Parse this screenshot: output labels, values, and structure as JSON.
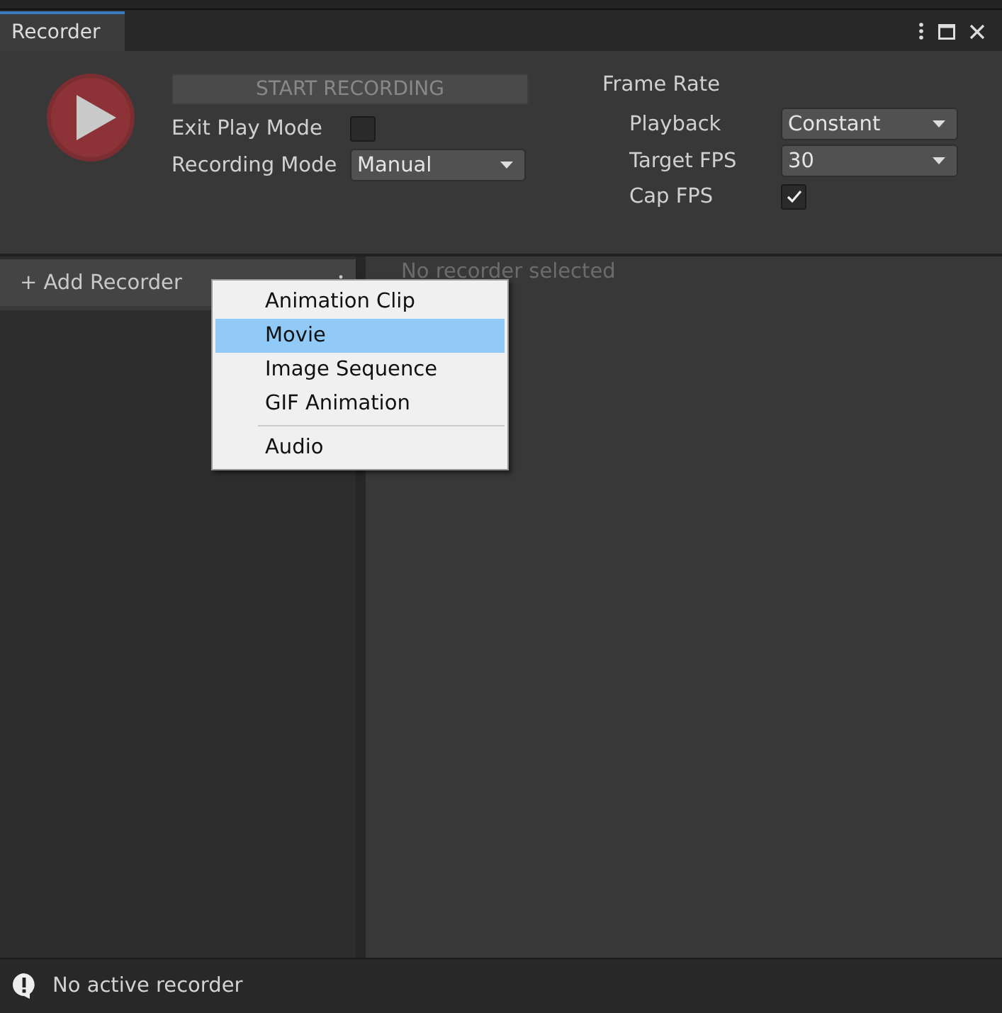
{
  "window": {
    "title": "Recorder"
  },
  "start_button": {
    "label": "START RECORDING",
    "disabled": true
  },
  "settings": [
    {
      "kind": "checkbox",
      "label": "Exit Play Mode",
      "checked": false
    },
    {
      "kind": "dropdown",
      "label": "Recording Mode",
      "value": "Manual"
    }
  ],
  "frame_rate": {
    "title": "Frame Rate",
    "fields": [
      {
        "kind": "dropdown",
        "label": "Playback",
        "value": "Constant"
      },
      {
        "kind": "dropdown",
        "label": "Target FPS",
        "value": "30"
      },
      {
        "kind": "checkbox",
        "label": "Cap FPS",
        "checked": true
      }
    ]
  },
  "add_recorder": {
    "label": "+ Add Recorder"
  },
  "detail": {
    "placeholder_text": "No recorder selected"
  },
  "menu": {
    "items": [
      {
        "label": "Animation Clip",
        "selected": false
      },
      {
        "label": "Movie",
        "selected": true
      },
      {
        "label": "Image Sequence",
        "selected": false
      },
      {
        "label": "GIF Animation",
        "selected": false
      },
      {
        "kind": "separator"
      },
      {
        "label": "Audio",
        "selected": false
      }
    ]
  },
  "status_bar": {
    "text": "No active recorder"
  }
}
